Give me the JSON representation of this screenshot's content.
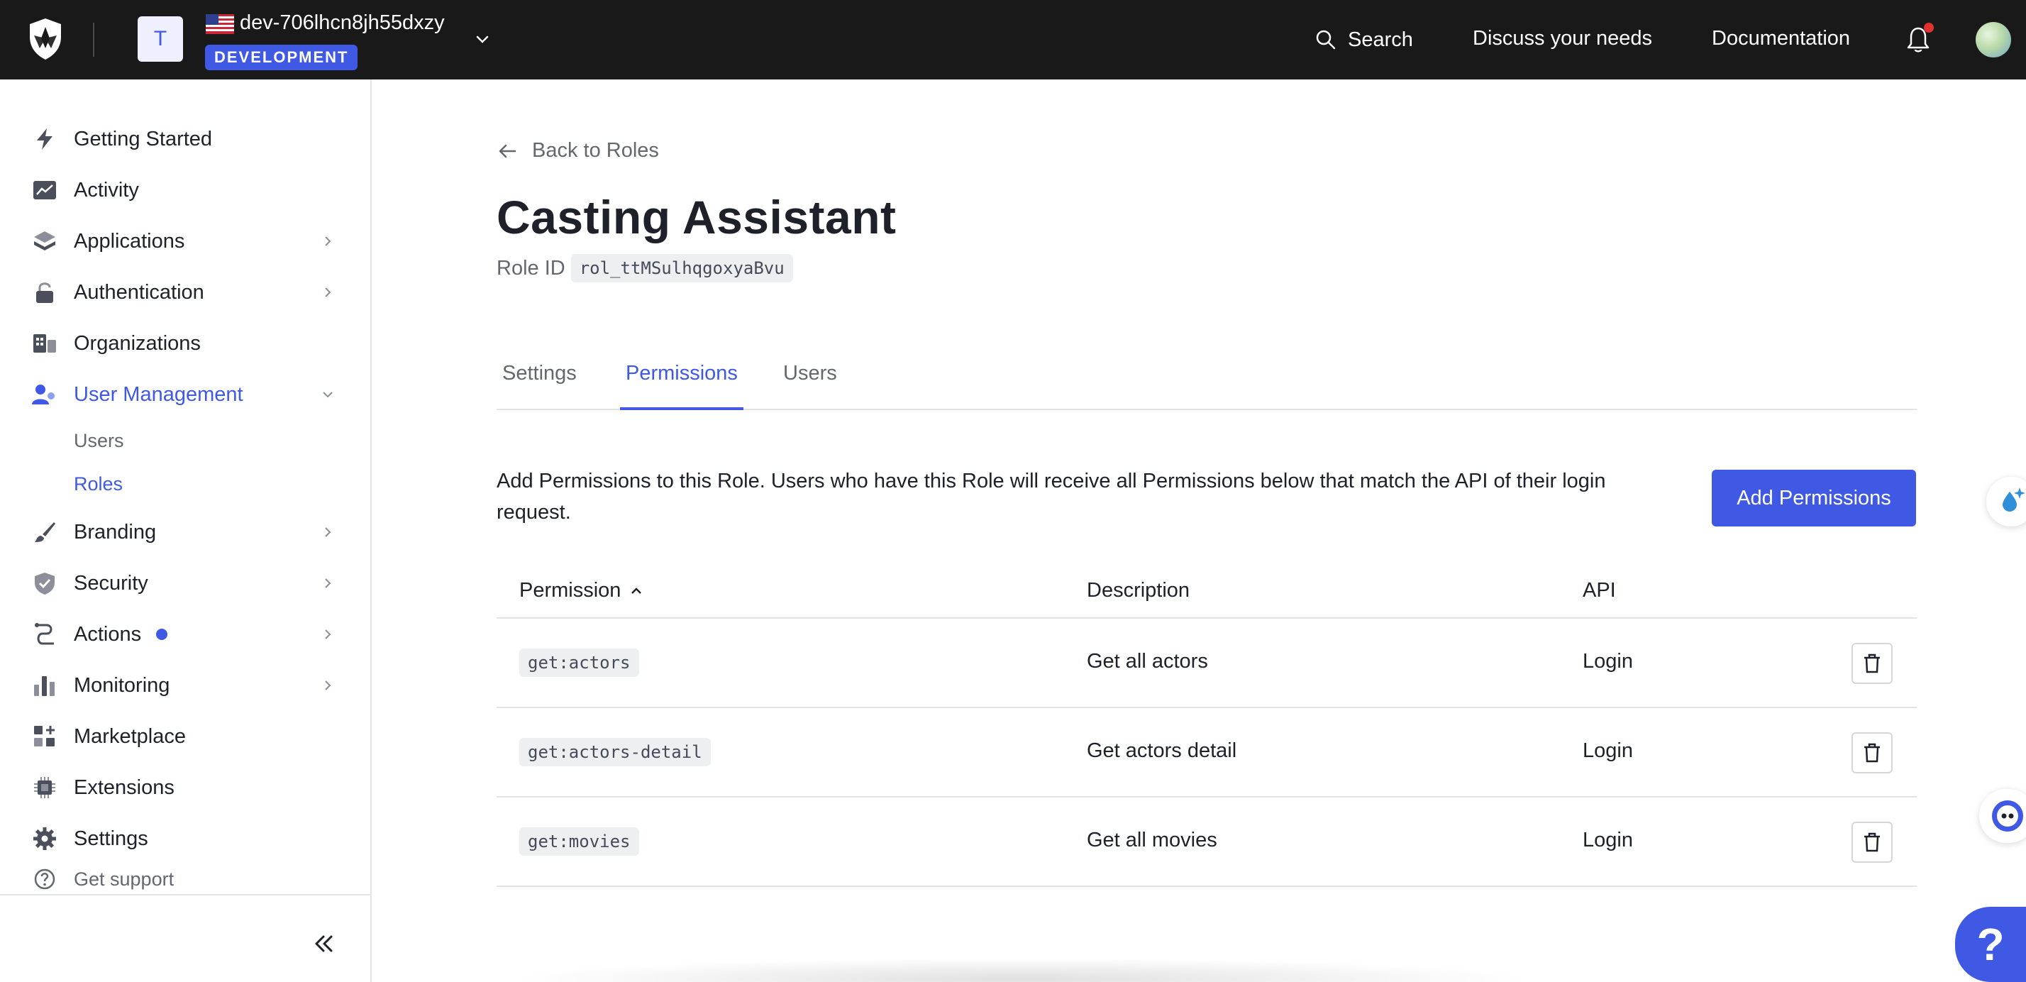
{
  "topbar": {
    "tenant_initial": "T",
    "tenant_name": "dev-706lhcn8jh55dxzy",
    "env_badge": "DEVELOPMENT",
    "search_label": "Search",
    "links": [
      "Discuss your needs",
      "Documentation"
    ],
    "brand_color": "#3f59e4"
  },
  "sidebar": {
    "items": [
      {
        "label": "Getting Started",
        "icon": "lightning-icon"
      },
      {
        "label": "Activity",
        "icon": "activity-chart-icon"
      },
      {
        "label": "Applications",
        "icon": "layers-icon"
      },
      {
        "label": "Authentication",
        "icon": "lock-icon"
      },
      {
        "label": "Organizations",
        "icon": "building-icon"
      },
      {
        "label": "User Management",
        "icon": "users-icon"
      },
      {
        "label": "Branding",
        "icon": "brush-icon"
      },
      {
        "label": "Security",
        "icon": "shield-check-icon"
      },
      {
        "label": "Actions",
        "icon": "flow-icon"
      },
      {
        "label": "Monitoring",
        "icon": "bar-chart-icon"
      },
      {
        "label": "Marketplace",
        "icon": "grid-plus-icon"
      },
      {
        "label": "Extensions",
        "icon": "chip-icon"
      },
      {
        "label": "Settings",
        "icon": "gear-icon"
      }
    ],
    "sub_items": [
      "Users",
      "Roles"
    ],
    "support_label": "Get support"
  },
  "main": {
    "back_label": "Back to Roles",
    "title": "Casting Assistant",
    "role_id_label": "Role ID",
    "role_id": "rol_ttMSulhqgoxyaBvu",
    "tabs": [
      "Settings",
      "Permissions",
      "Users"
    ],
    "active_tab": "Permissions",
    "description": "Add Permissions to this Role. Users who have this Role will receive all Permissions below that match the API of their login request.",
    "add_button": "Add Permissions",
    "table": {
      "columns": [
        "Permission",
        "Description",
        "API"
      ],
      "rows": [
        {
          "permission": "get:actors",
          "description": "Get all actors",
          "api": "Login"
        },
        {
          "permission": "get:actors-detail",
          "description": "Get actors detail",
          "api": "Login"
        },
        {
          "permission": "get:movies",
          "description": "Get all movies",
          "api": "Login"
        }
      ]
    }
  },
  "help_label": "?"
}
